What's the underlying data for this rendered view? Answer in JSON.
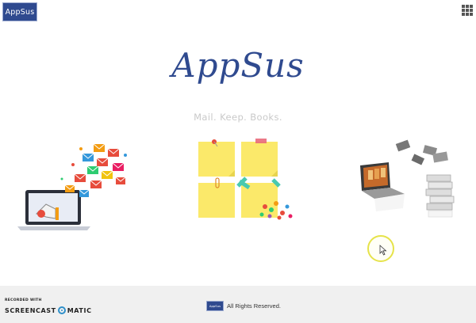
{
  "header": {
    "logo_label": "AppSus",
    "apps_icon": "grid-apps-icon"
  },
  "hero": {
    "title": "AppSus",
    "subtitle": "Mail. Keep. Books."
  },
  "illustrations": {
    "mail_icon": "email-marketing-illustration",
    "keep_icon": "sticky-notes-illustration",
    "books_icon": "books-laptop-illustration"
  },
  "footer": {
    "logo_label": "AppSus",
    "rights": "All Rights Reserved."
  },
  "watermark": {
    "small": "RECORDED WITH",
    "big_left": "SCREENCAST",
    "big_right": "MATIC"
  },
  "colors": {
    "brand": "#2f4a8f",
    "subtitle": "#c9c9c9",
    "footer_bg": "#f0f0f0",
    "cursor_ring": "#e6e34a"
  }
}
